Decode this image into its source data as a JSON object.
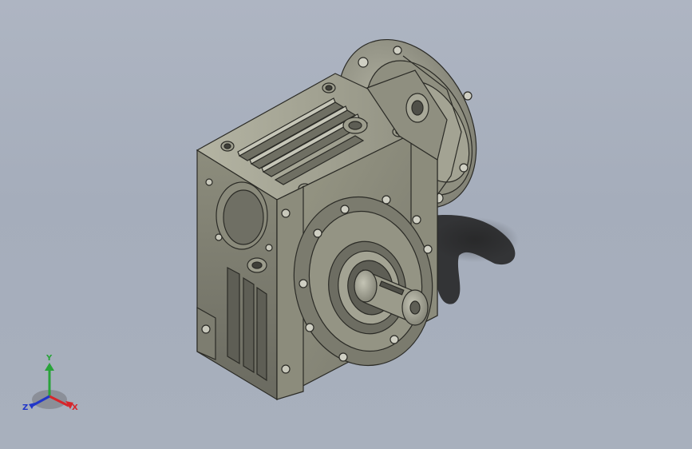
{
  "viewport": {
    "background_top": "#aeb5c2",
    "background_bottom": "#a8b0bd",
    "model_color": "#8a8a78",
    "edge_color": "#2b2b26"
  },
  "triad": {
    "x_label": "X",
    "y_label": "Y",
    "z_label": "Z",
    "x_color": "#d7262b",
    "y_color": "#29a33a",
    "z_color": "#2136c9"
  }
}
